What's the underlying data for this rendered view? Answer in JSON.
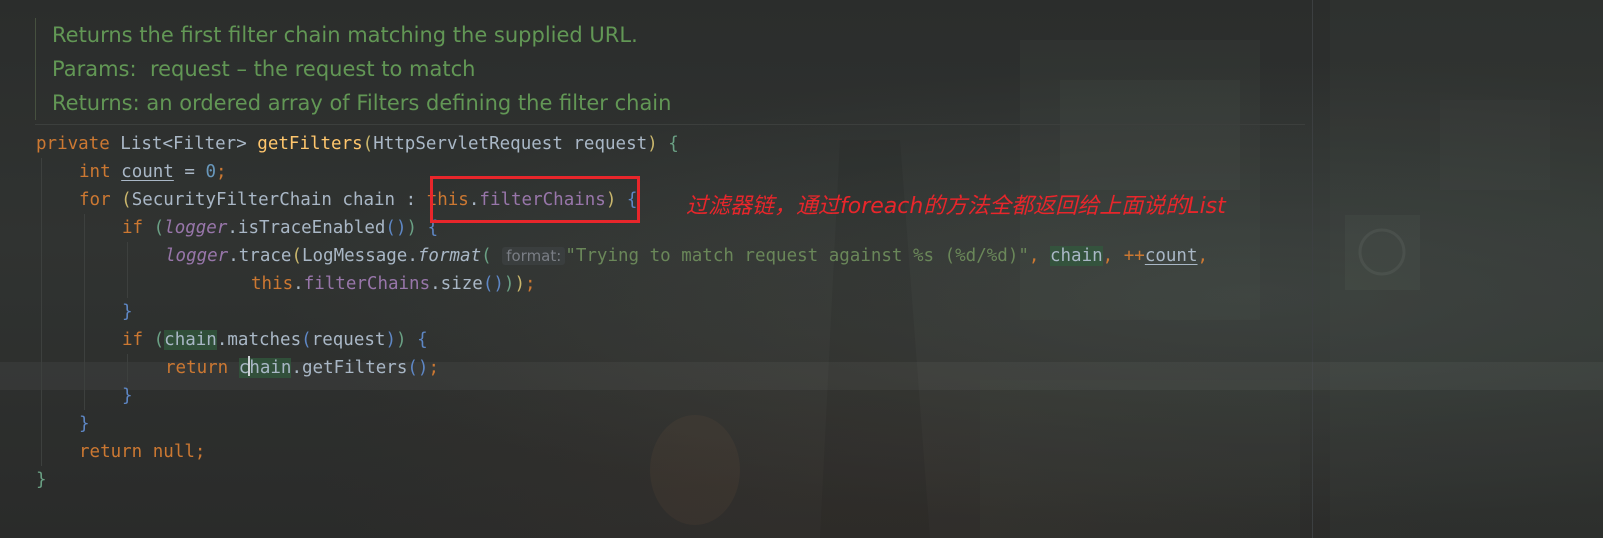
{
  "doc": {
    "summary": "Returns the first filter chain matching the supplied URL.",
    "params_label": "Params:",
    "params_text": "request – the request to match",
    "returns_label": "Returns:",
    "returns_text": "an ordered array of Filters defining the filter chain"
  },
  "code": {
    "l1": {
      "kw": "private",
      "t1": " List",
      "p1": "<",
      "t2": "Filter",
      "p2": "> ",
      "fn": "getFilters",
      "p3": "(",
      "t3": "HttpServletRequest request",
      "p4": ")",
      "p5": " {"
    },
    "l2": {
      "kw": "int",
      "var": "count",
      "t1": " = ",
      "num": "0",
      "t2": ";"
    },
    "l3": {
      "kw": "for",
      "p1": " (",
      "t1": "SecurityFilterChain chain : ",
      "kw2": "this",
      "dot": ".",
      "fld": "filterChains",
      "p2": ")",
      "p3": " {"
    },
    "l4": {
      "kw": "if",
      "p1": " (",
      "logger": "logger",
      "t1": ".isTraceEnabled",
      "p2": "()",
      "p3": ")",
      "p4": " {"
    },
    "l5": {
      "logger": "logger",
      "t1": ".trace",
      "p1": "(",
      "t2": "LogMessage.",
      "fmt": "format",
      "p2": "(",
      "hint": "format:",
      "str": "\"Trying to match request against %s (%d/%d)\"",
      "t3": ", ",
      "chain": "chain",
      "t4": ", ++",
      "count": "count",
      "t5": ","
    },
    "l6": {
      "kw": "this",
      "dot": ".",
      "fld": "filterChains",
      "t1": ".size",
      "p1": "()",
      "p2": ")",
      "p3": ")",
      "t2": ";"
    },
    "l7": {
      "brace": "}"
    },
    "l8": {
      "kw": "if",
      "p1": " (",
      "chain": "chain",
      "t1": ".matches",
      "p2": "(",
      "t2": "request",
      "p3": ")",
      "p4": ")",
      "p5": " {"
    },
    "l9": {
      "kw": "return",
      "t0": " ",
      "c1": "c",
      "c2": "hain",
      "t1": ".getFilters",
      "p1": "()",
      "t2": ";"
    },
    "l10": {
      "brace": "}"
    },
    "l11": {
      "brace": "}"
    },
    "l12": {
      "kw": "return",
      "t1": " ",
      "kw2": "null",
      "t2": ";"
    },
    "l13": {
      "brace": "}"
    }
  },
  "annotation": {
    "text": "过滤器链，通过foreach的方法全都返回给上面说的List",
    "color": "#e8262b"
  }
}
